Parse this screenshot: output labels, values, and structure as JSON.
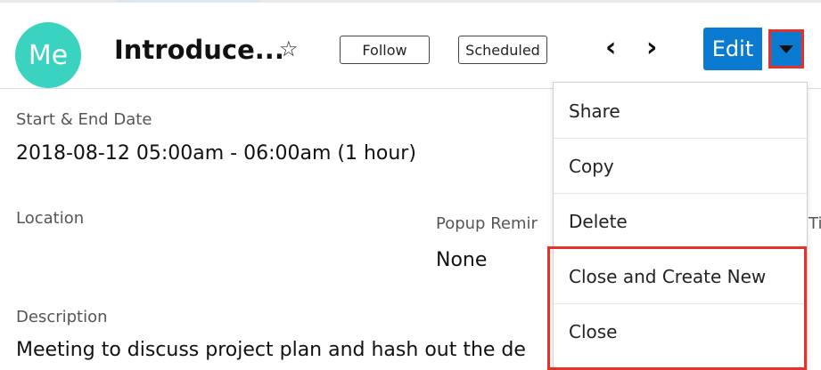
{
  "record": {
    "avatar_text": "Me",
    "title": "Introduce...",
    "follow_label": "Follow",
    "status_label": "Scheduled",
    "edit_label": "Edit"
  },
  "icons": {
    "star": "star-icon",
    "prev": "chevron-left-icon",
    "next": "chevron-right-icon",
    "caret": "caret-down-icon"
  },
  "fields": {
    "start_end_label": "Start & End Date",
    "start_end_value": "2018-08-12 05:00am - 06:00am (1 hour)",
    "location_label": "Location",
    "popup_label": "Popup Remir",
    "popup_value": "None",
    "right_clip_label": "Ti",
    "description_label": "Description",
    "description_value": "Meeting to discuss project plan and hash out the de"
  },
  "menu": {
    "items": [
      {
        "label": "Share"
      },
      {
        "label": "Copy"
      },
      {
        "label": "Delete"
      },
      {
        "label": "Close and Create New"
      },
      {
        "label": "Close"
      }
    ]
  },
  "colors": {
    "avatar": "#39d3bf",
    "primary": "#0a7bd1",
    "highlight": "#e4312b"
  }
}
